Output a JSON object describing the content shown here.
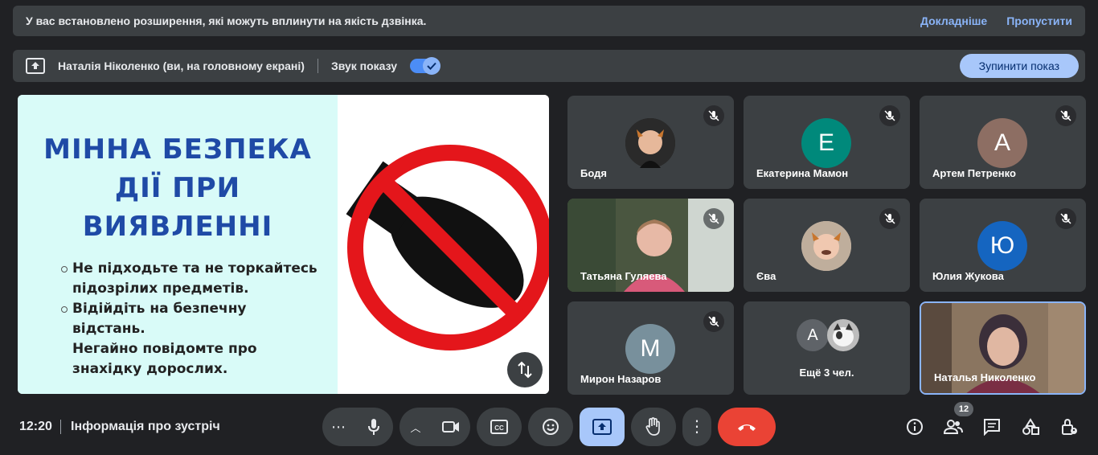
{
  "notice": {
    "message": "У вас встановлено розширення, які можуть вплинути на якість дзвінка.",
    "details_link": "Докладніше",
    "skip_link": "Пропустити"
  },
  "sharebar": {
    "presenter": "Наталія Ніколенко (ви, на головному екрані)",
    "sound_label": "Звук показу",
    "sound_enabled": true,
    "stop_button": "Зупинити показ"
  },
  "slide": {
    "title_lines": [
      "МІННА БЕЗПЕКА",
      "ДІЇ ПРИ",
      "ВИЯВЛЕННІ"
    ],
    "bullets": [
      "Не підходьте та не торкайтесь",
      "підозрілих предметів.",
      "Відійдіть на безпечну",
      "відстань.",
      "Негайно повідомте про",
      "знахідку  дорослих."
    ]
  },
  "participants": [
    {
      "name": "Бодя",
      "muted": true,
      "avatar_type": "photo"
    },
    {
      "name": "Екатерина Мамон",
      "muted": true,
      "initial": "Е",
      "color": "#00897b"
    },
    {
      "name": "Артем Петренко",
      "muted": true,
      "initial": "А",
      "color": "#8d6e63"
    },
    {
      "name": "Татьяна Гуляева",
      "muted": true,
      "avatar_type": "video"
    },
    {
      "name": "Єва",
      "muted": true,
      "avatar_type": "photo"
    },
    {
      "name": "Юлия Жукова",
      "muted": true,
      "initial": "Ю",
      "color": "#1565c0"
    },
    {
      "name": "Мирон Назаров",
      "muted": true,
      "initial": "М",
      "color": "#78909c"
    },
    {
      "name": "Ещё 3 чел.",
      "initial": "А",
      "color": "#5f6368"
    },
    {
      "name": "Наталья Николенко",
      "avatar_type": "video"
    }
  ],
  "bottom": {
    "time": "12:20",
    "meeting_info": "Інформація про зустріч",
    "participant_count": "12"
  },
  "colors": {
    "background": "#202124",
    "surface": "#3c4043",
    "accent": "#a8c7fa",
    "hangup": "#ea4335"
  }
}
